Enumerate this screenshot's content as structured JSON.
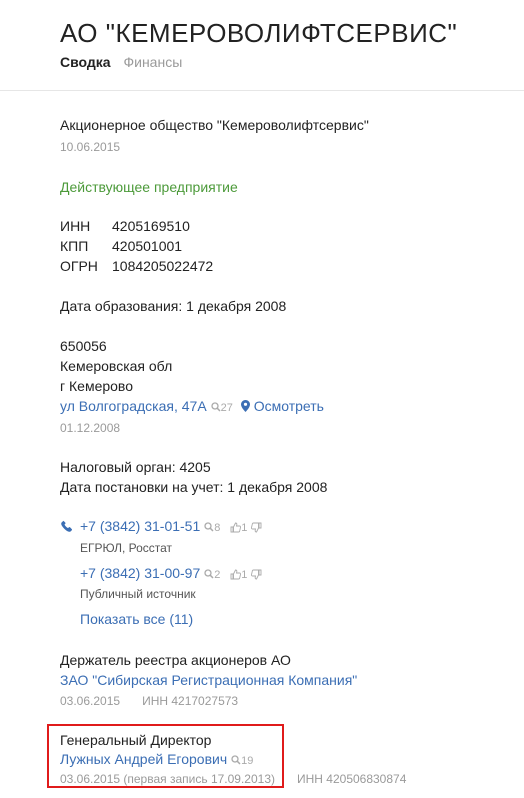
{
  "header": {
    "title": "АО \"КЕМЕРОВОЛИФТСЕРВИС\"",
    "tabs": [
      {
        "label": "Сводка",
        "active": true
      },
      {
        "label": "Финансы",
        "active": false
      }
    ]
  },
  "company": {
    "full_name": "Акционерное общество \"Кемероволифтсервис\"",
    "full_name_date": "10.06.2015",
    "status": "Действующее предприятие",
    "inn_label": "ИНН",
    "inn": "4205169510",
    "kpp_label": "КПП",
    "kpp": "420501001",
    "ogrn_label": "ОГРН",
    "ogrn": "1084205022472",
    "founded": "Дата образования: 1 декабря 2008"
  },
  "address": {
    "postcode": "650056",
    "region": "Кемеровская обл",
    "city": "г Кемерово",
    "street": "ул Волгоградская, 47А",
    "street_count": "27",
    "view_label": "Осмотреть",
    "date": "01.12.2008"
  },
  "tax": {
    "organ": "Налоговый орган: 4205",
    "registered": "Дата постановки на учет: 1 декабря 2008"
  },
  "phones": [
    {
      "number": "+7 (3842) 31-01-51",
      "count": "8",
      "likes": "1",
      "source": "ЕГРЮЛ, Росстат"
    },
    {
      "number": "+7 (3842) 31-00-97",
      "count": "2",
      "likes": "1",
      "source": "Публичный источник"
    }
  ],
  "show_all": "Показать все (11)",
  "registry": {
    "title": "Держатель реестра акционеров АО",
    "name": "ЗАО \"Сибирская Регистрационная Компания\"",
    "date": "03.06.2015",
    "inn": "ИНН 4217027573"
  },
  "director": {
    "title": "Генеральный Директор",
    "name": "Лужных Андрей Егорович",
    "count": "19",
    "date": "03.06.2015 (первая запись 17.09.2013)",
    "inn": "ИНН 420506830874"
  },
  "colors": {
    "link": "#3b6eb4",
    "status": "#4c9a3a",
    "highlight": "#e01b1b"
  }
}
